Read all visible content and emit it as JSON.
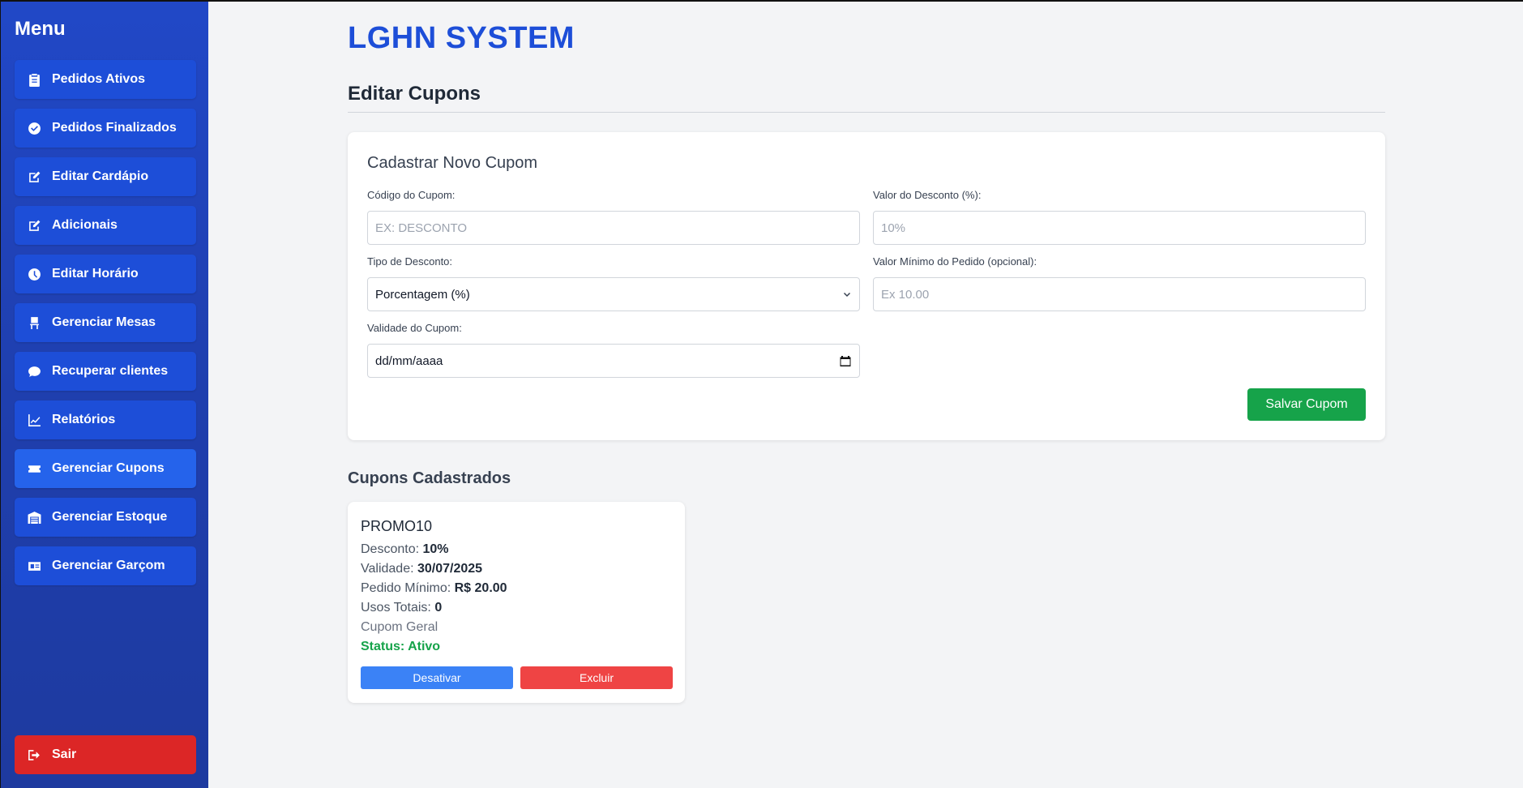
{
  "sidebar": {
    "title": "Menu",
    "items": [
      {
        "label": "Pedidos Ativos",
        "icon": "clipboard-icon"
      },
      {
        "label": "Pedidos Finalizados",
        "icon": "check-circle-icon"
      },
      {
        "label": "Editar Cardápio",
        "icon": "edit-icon"
      },
      {
        "label": "Adicionais",
        "icon": "edit-icon"
      },
      {
        "label": "Editar Horário",
        "icon": "clock-icon"
      },
      {
        "label": "Gerenciar Mesas",
        "icon": "chair-icon"
      },
      {
        "label": "Recuperar clientes",
        "icon": "chat-icon"
      },
      {
        "label": "Relatórios",
        "icon": "chart-line-icon"
      },
      {
        "label": "Gerenciar Cupons",
        "icon": "ticket-icon",
        "active": true
      },
      {
        "label": "Gerenciar Estoque",
        "icon": "warehouse-icon"
      },
      {
        "label": "Gerenciar Garçom",
        "icon": "id-card-icon"
      }
    ],
    "logout_label": "Sair"
  },
  "header": {
    "system_title": "LGHN SYSTEM",
    "page_title": "Editar Cupons"
  },
  "form": {
    "title": "Cadastrar Novo Cupom",
    "code_label": "Código do Cupom:",
    "code_placeholder": "EX: DESCONTO",
    "discount_label": "Valor do Desconto (%):",
    "discount_placeholder": "10%",
    "type_label": "Tipo de Desconto:",
    "type_value": "Porcentagem (%)",
    "min_label": "Valor Mínimo do Pedido (opcional):",
    "min_placeholder": "Ex 10.00",
    "validity_label": "Validade do Cupom:",
    "validity_value": "dd/mm/aaaa",
    "save_label": "Salvar Cupom"
  },
  "coupons": {
    "section_title": "Cupons Cadastrados",
    "items": [
      {
        "code": "PROMO10",
        "discount_label": "Desconto:",
        "discount": "10%",
        "validity_label": "Validade:",
        "validity": "30/07/2025",
        "min_label": "Pedido Mínimo:",
        "min": "R$ 20.00",
        "uses_label": "Usos Totais:",
        "uses": "0",
        "scope": "Cupom Geral",
        "status": "Status: Ativo",
        "deactivate_label": "Desativar",
        "delete_label": "Excluir"
      }
    ]
  },
  "colors": {
    "sidebar": "#1e40af",
    "menu_item": "#1d4ed8",
    "active_item": "#2563eb",
    "logout": "#dc2626",
    "title": "#1d4ed8",
    "save": "#16a34a",
    "deactivate": "#3b82f6",
    "delete": "#ef4444",
    "status_active": "#16a34a"
  }
}
